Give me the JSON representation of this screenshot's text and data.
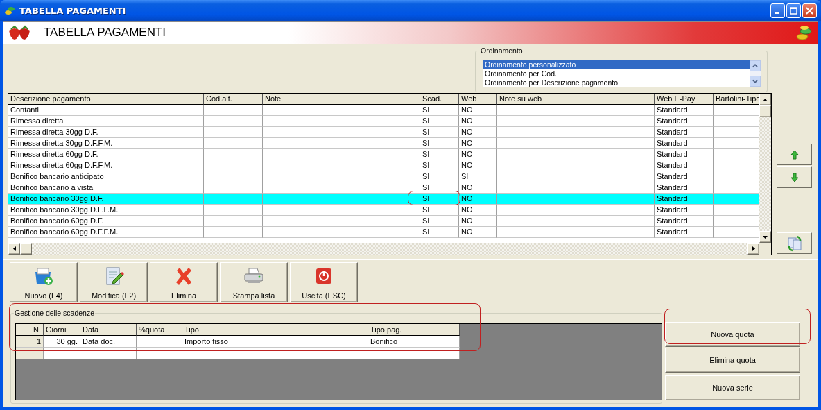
{
  "window": {
    "title": "TABELLA PAGAMENTI"
  },
  "header": {
    "title": "TABELLA PAGAMENTI"
  },
  "ordering": {
    "label": "Ordinamento",
    "options": [
      {
        "label": "Ordinamento personalizzato",
        "selected": true
      },
      {
        "label": "Ordinamento per Cod.",
        "selected": false
      },
      {
        "label": "Ordinamento per Descrizione pagamento",
        "selected": false
      }
    ]
  },
  "table": {
    "columns": [
      "Descrizione pagamento",
      "Cod.alt.",
      "Note",
      "Scad.",
      "Web",
      "Note su web",
      "Web E-Pay",
      "Bartolini-Tipo"
    ],
    "rows": [
      {
        "cells": [
          "Contanti",
          null,
          null,
          "SI",
          "NO",
          null,
          "Standard",
          null
        ],
        "selected": false
      },
      {
        "cells": [
          "Rimessa diretta",
          null,
          null,
          "SI",
          "NO",
          null,
          "Standard",
          null
        ],
        "selected": false
      },
      {
        "cells": [
          "Rimessa diretta 30gg D.F.",
          null,
          null,
          "SI",
          "NO",
          null,
          "Standard",
          null
        ],
        "selected": false
      },
      {
        "cells": [
          "Rimessa diretta 30gg D.F.F.M.",
          null,
          null,
          "SI",
          "NO",
          null,
          "Standard",
          null
        ],
        "selected": false
      },
      {
        "cells": [
          "Rimessa diretta 60gg D.F.",
          null,
          null,
          "SI",
          "NO",
          null,
          "Standard",
          null
        ],
        "selected": false
      },
      {
        "cells": [
          "Rimessa diretta 60gg D.F.F.M.",
          null,
          null,
          "SI",
          "NO",
          null,
          "Standard",
          null
        ],
        "selected": false
      },
      {
        "cells": [
          "Bonifico bancario anticipato",
          null,
          null,
          "SI",
          "SI",
          null,
          "Standard",
          null
        ],
        "selected": false
      },
      {
        "cells": [
          "Bonifico bancario a vista",
          null,
          null,
          "SI",
          "NO",
          null,
          "Standard",
          null
        ],
        "selected": false
      },
      {
        "cells": [
          "Bonifico bancario 30gg D.F.",
          null,
          null,
          "SI",
          "NO",
          null,
          "Standard",
          null
        ],
        "selected": true
      },
      {
        "cells": [
          "Bonifico bancario 30gg D.F.F.M.",
          null,
          null,
          "SI",
          "NO",
          null,
          "Standard",
          null
        ],
        "selected": false
      },
      {
        "cells": [
          "Bonifico bancario 60gg D.F.",
          null,
          null,
          "SI",
          "NO",
          null,
          "Standard",
          null
        ],
        "selected": false
      },
      {
        "cells": [
          "Bonifico bancario 60gg D.F.F.M.",
          null,
          null,
          "SI",
          "NO",
          null,
          "Standard",
          null
        ],
        "selected": false
      }
    ]
  },
  "toolbar": [
    {
      "kind": "new",
      "label": "Nuovo (F4)"
    },
    {
      "kind": "edit",
      "label": "Modifica (F2)"
    },
    {
      "kind": "delete",
      "label": "Elimina"
    },
    {
      "kind": "print",
      "label": "Stampa lista"
    },
    {
      "kind": "exit",
      "label": "Uscita (ESC)"
    }
  ],
  "schedule": {
    "title": "Gestione delle scadenze",
    "columns": [
      "N.",
      "Giorni",
      "Data",
      "%quota",
      "Tipo",
      "Tipo pag."
    ],
    "rows": [
      {
        "cells": [
          "1",
          "30 gg.",
          "Data doc.",
          null,
          "Importo fisso",
          "Bonifico"
        ]
      }
    ]
  },
  "schedule_buttons": [
    "Nuova quota",
    "Elimina quota",
    "Nuova serie"
  ]
}
